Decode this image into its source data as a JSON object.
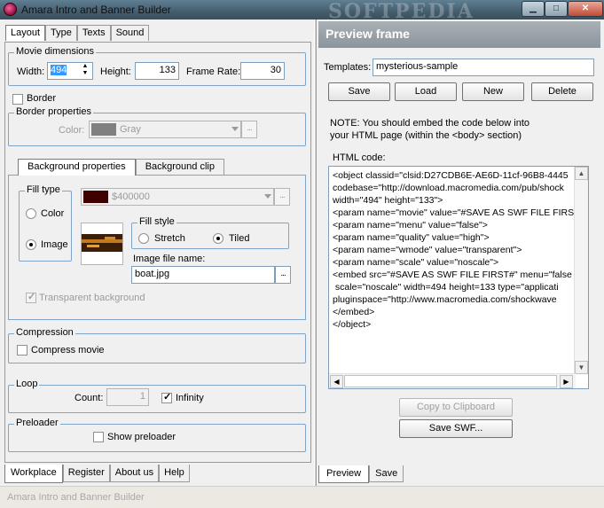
{
  "window": {
    "title": "Amara Intro and Banner Builder",
    "watermark": "SOFTPEDIA"
  },
  "left": {
    "tabs": [
      "Layout",
      "Type",
      "Texts",
      "Sound"
    ],
    "movie_dimensions": {
      "title": "Movie dimensions",
      "width_label": "Width:",
      "width_value": "494",
      "height_label": "Height:",
      "height_value": "133",
      "framerate_label": "Frame Rate:",
      "framerate_value": "30"
    },
    "border_checkbox": "Border",
    "border_properties": {
      "title": "Border properties",
      "color_label": "Color:",
      "color_value": "Gray",
      "color_swatch": "#808080",
      "ellipsis": "..."
    },
    "bg_tabs": [
      "Background properties",
      "Background clip"
    ],
    "fill_type": {
      "title": "Fill type",
      "color_label": "Color",
      "image_label": "Image"
    },
    "fill_color_value": "$400000",
    "fill_color_swatch": "#400000",
    "fill_style": {
      "title": "Fill style",
      "stretch_label": "Stretch",
      "tiled_label": "Tiled"
    },
    "image_file_label": "Image file name:",
    "image_file_value": "boat.jpg",
    "transparent_bg_label": "Transparent background",
    "compression": {
      "title": "Compression",
      "checkbox_label": "Compress movie"
    },
    "loop": {
      "title": "Loop",
      "count_label": "Count:",
      "count_value": "1",
      "infinity_label": "Infinity"
    },
    "preloader": {
      "title": "Preloader",
      "checkbox_label": "Show preloader"
    },
    "bottom_tabs": [
      "Workplace",
      "Register",
      "About us",
      "Help"
    ]
  },
  "right": {
    "header": "Preview frame",
    "templates_label": "Templates:",
    "templates_value": "mysterious-sample",
    "buttons": [
      "Save",
      "Load",
      "New",
      "Delete"
    ],
    "note": "NOTE: You should embed the code below into\nyour HTML page (within the <body> section)",
    "html_code_label": "HTML code:",
    "html_code": "<object classid=\"clsid:D27CDB6E-AE6D-11cf-96B8-4445\ncodebase=\"http://download.macromedia.com/pub/shock\nwidth=\"494\" height=\"133\">\n<param name=\"movie\" value=\"#SAVE AS SWF FILE FIRST\n<param name=\"menu\" value=\"false\">\n<param name=\"quality\" value=\"high\">\n<param name=\"wmode\" value=\"transparent\">\n<param name=\"scale\" value=\"noscale\">\n<embed src=\"#SAVE AS SWF FILE FIRST#\" menu=\"false\n scale=\"noscale\" width=494 height=133 type=\"applicati\npluginspace=\"http://www.macromedia.com/shockwave\n</embed>\n</object>",
    "copy_button": "Copy to Clipboard",
    "save_swf_button": "Save SWF...",
    "bottom_tabs": [
      "Preview",
      "Save"
    ]
  },
  "status_bar": "Amara Intro and Banner Builder"
}
